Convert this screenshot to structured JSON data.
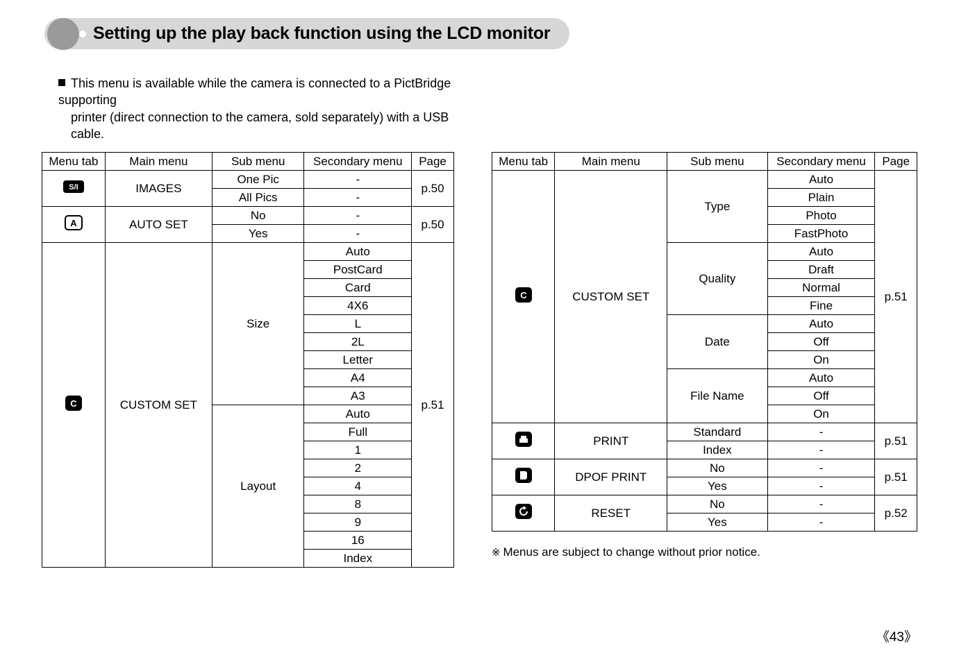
{
  "title": "Setting up the play back function using the LCD monitor",
  "intro_line1": "This menu is available while the camera is connected to a PictBridge supporting",
  "intro_line2": "printer (direct connection to the camera, sold separately) with a USB cable.",
  "headers": {
    "menu_tab": "Menu tab",
    "main_menu": "Main menu",
    "sub_menu": "Sub menu",
    "secondary_menu": "Secondary menu",
    "page": "Page"
  },
  "left": {
    "images": {
      "main": "IMAGES",
      "sub1": "One Pic",
      "sub2": "All Pics",
      "sec1": "-",
      "sec2": "-",
      "page": "p.50"
    },
    "autoset": {
      "main": "AUTO SET",
      "sub1": "No",
      "sub2": "Yes",
      "sec1": "-",
      "sec2": "-",
      "page": "p.50"
    },
    "custom": {
      "main": "CUSTOM SET",
      "page": "p.51",
      "size_sub": "Size",
      "size_values": [
        "Auto",
        "PostCard",
        "Card",
        "4X6",
        "L",
        "2L",
        "Letter",
        "A4",
        "A3"
      ],
      "layout_sub": "Layout",
      "layout_values": [
        "Auto",
        "Full",
        "1",
        "2",
        "4",
        "8",
        "9",
        "16",
        "Index"
      ]
    }
  },
  "right": {
    "custom": {
      "main": "CUSTOM SET",
      "page": "p.51",
      "type_sub": "Type",
      "type_values": [
        "Auto",
        "Plain",
        "Photo",
        "FastPhoto"
      ],
      "quality_sub": "Quality",
      "quality_values": [
        "Auto",
        "Draft",
        "Normal",
        "Fine"
      ],
      "date_sub": "Date",
      "date_values": [
        "Auto",
        "Off",
        "On"
      ],
      "filename_sub": "File Name",
      "filename_values": [
        "Auto",
        "Off",
        "On"
      ]
    },
    "print": {
      "main": "PRINT",
      "sub1": "Standard",
      "sub2": "Index",
      "sec1": "-",
      "sec2": "-",
      "page": "p.51"
    },
    "dpof": {
      "main": "DPOF PRINT",
      "sub1": "No",
      "sub2": "Yes",
      "sec1": "-",
      "sec2": "-",
      "page": "p.51"
    },
    "reset": {
      "main": "RESET",
      "sub1": "No",
      "sub2": "Yes",
      "sec1": "-",
      "sec2": "-",
      "page": "p.52"
    }
  },
  "footnote": "Menus are subject to change without prior notice.",
  "pagenum": "《43》"
}
